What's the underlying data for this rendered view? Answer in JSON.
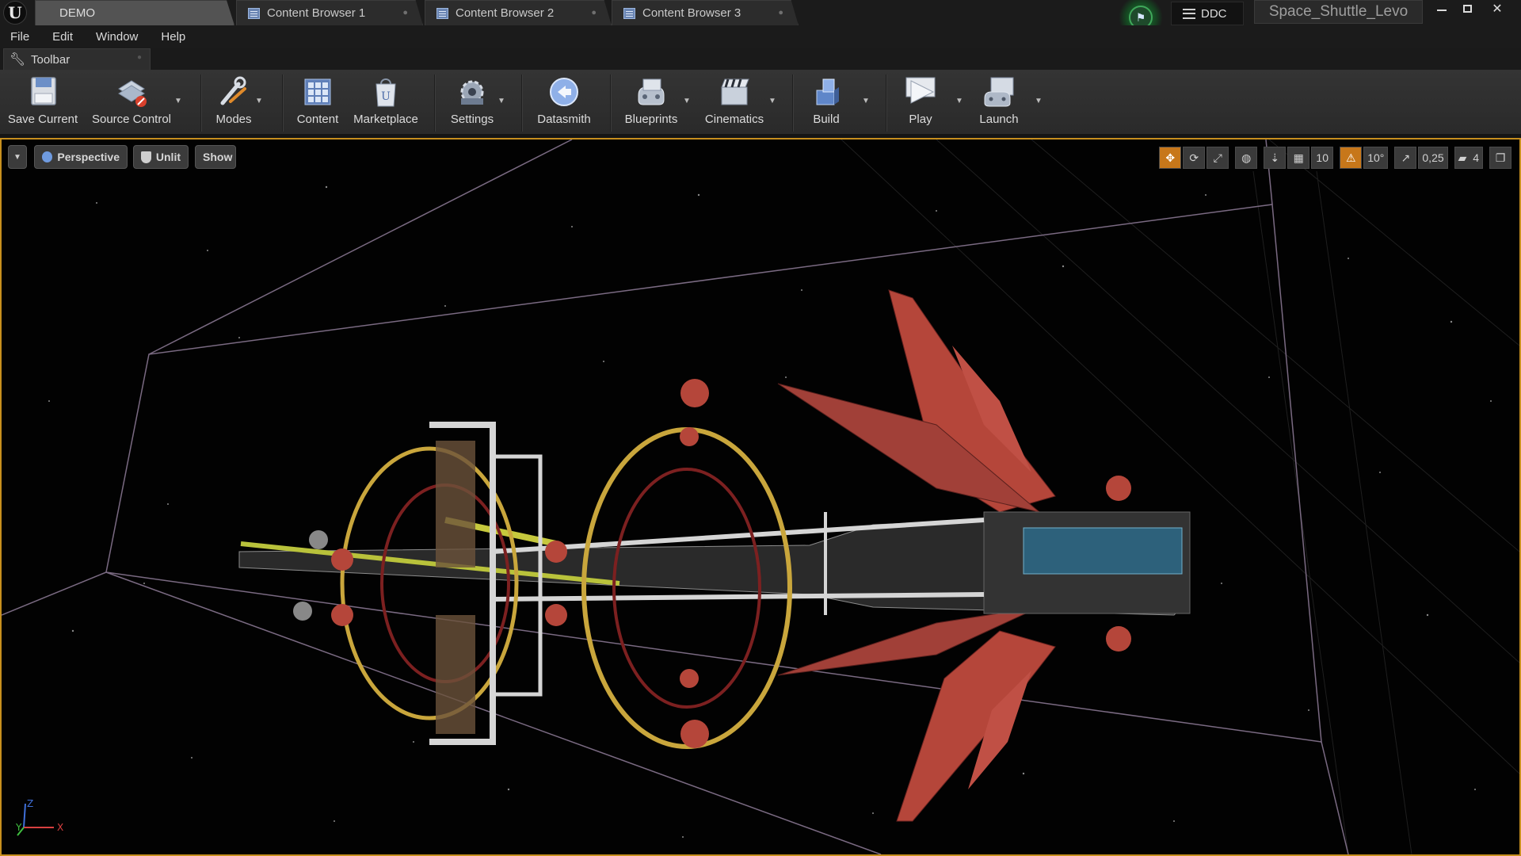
{
  "titlebar": {
    "tabs": [
      {
        "label": "DEMO",
        "active": true
      },
      {
        "label": "Content Browser 1",
        "active": false
      },
      {
        "label": "Content Browser 2",
        "active": false
      },
      {
        "label": "Content Browser 3",
        "active": false
      }
    ],
    "ddc_label": "DDC",
    "project_name": "Space_Shuttle_Levo",
    "window_controls": [
      "minimize",
      "restore",
      "close"
    ],
    "close_glyph": "✕"
  },
  "menubar": {
    "items": [
      "File",
      "Edit",
      "Window",
      "Help"
    ]
  },
  "panel_tab": {
    "label": "Toolbar"
  },
  "toolbar": {
    "buttons": [
      {
        "label": "Save Current",
        "icon": "save-icon"
      },
      {
        "label": "Source Control",
        "icon": "source-control-icon",
        "dropdown": true
      },
      {
        "label": "Modes",
        "icon": "modes-icon",
        "dropdown": true
      },
      {
        "label": "Content",
        "icon": "content-icon"
      },
      {
        "label": "Marketplace",
        "icon": "marketplace-icon"
      },
      {
        "label": "Settings",
        "icon": "settings-icon",
        "dropdown": true
      },
      {
        "label": "Datasmith",
        "icon": "datasmith-icon"
      },
      {
        "label": "Blueprints",
        "icon": "blueprints-icon",
        "dropdown": true
      },
      {
        "label": "Cinematics",
        "icon": "cinematics-icon",
        "dropdown": true
      },
      {
        "label": "Build",
        "icon": "build-icon",
        "dropdown": true
      },
      {
        "label": "Play",
        "icon": "play-icon",
        "dropdown": true
      },
      {
        "label": "Launch",
        "icon": "launch-icon",
        "dropdown": true
      }
    ]
  },
  "viewport": {
    "view_mode": "Perspective",
    "lighting_mode": "Unlit",
    "show_label": "Show",
    "grid_snap_value": "10",
    "rotation_snap_value": "10°",
    "scale_snap_value": "0,25",
    "camera_speed_value": "4",
    "accent_color": "#c78f1e",
    "axis_labels": {
      "x": "X",
      "y": "Y",
      "z": "Z"
    }
  }
}
